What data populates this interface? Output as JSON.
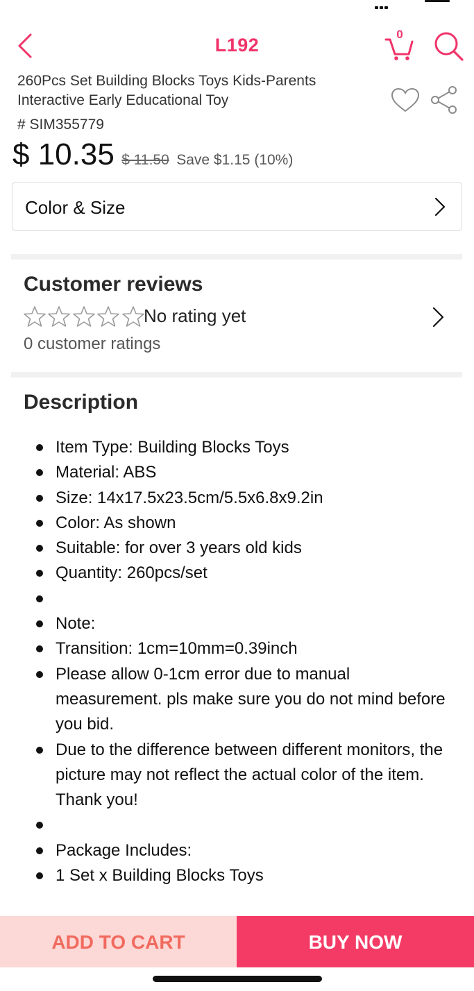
{
  "colors": {
    "accent": "#f0346a",
    "buy_bg": "#f43b66",
    "cart_bg": "#fcd8d6",
    "cart_text": "#f16a5e"
  },
  "header": {
    "title": "L192",
    "cart_count": "0",
    "icons": [
      "chevron-left-icon",
      "cart-icon",
      "search-icon"
    ]
  },
  "product": {
    "title": "260Pcs Set Building Blocks Toys Kids-Parents Interactive Early Educational Toy",
    "sku": "# SIM355779",
    "price": "$ 10.35",
    "original_price": "$ 11.50",
    "save_text": "Save $1.15 (10%)",
    "icons": [
      "heart-icon",
      "share-icon"
    ]
  },
  "variant": {
    "label": "Color & Size"
  },
  "reviews": {
    "title": "Customer reviews",
    "rating_text": "No rating yet",
    "stars": 0,
    "stars_max": 5,
    "count_text": "0 customer ratings"
  },
  "description": {
    "title": "Description",
    "items": [
      "Item Type: Building Blocks Toys",
      "Material: ABS",
      "Size: 14x17.5x23.5cm/5.5x6.8x9.2in",
      "Color: As shown",
      "Suitable: for over 3 years old kids",
      "Quantity: 260pcs/set",
      "",
      "Note:",
      "Transition: 1cm=10mm=0.39inch",
      "Please allow 0-1cm error due to manual measurement. pls make sure you do not mind before you bid.",
      "Due to the difference between different monitors, the picture may not reflect the actual color of the item. Thank you!",
      "",
      "Package Includes:",
      "1 Set x Building Blocks Toys"
    ]
  },
  "actions": {
    "add_to_cart": "ADD TO CART",
    "buy_now": "BUY NOW"
  }
}
